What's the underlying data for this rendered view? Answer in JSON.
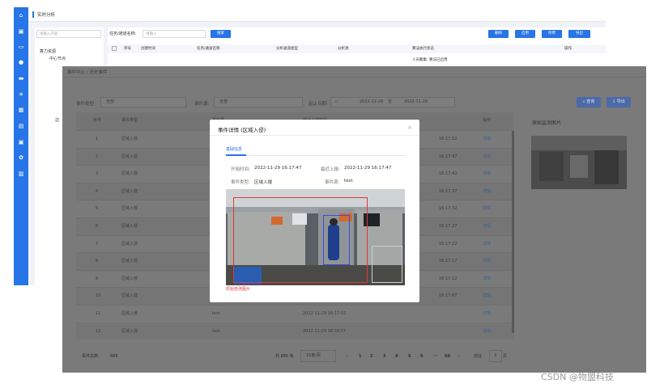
{
  "back": {
    "title": "实时分析",
    "search_placeholder": "请输入内容",
    "task_label": "任务/通道名称:",
    "task_placeholder": "请输入",
    "search_btn": "搜索",
    "actions": [
      "删除",
      "启用",
      "停用",
      "导出"
    ],
    "tree": [
      "算力资源",
      "中心节点",
      "边"
    ],
    "columns": [
      "序号",
      "创建时间",
      "任务/通道名称",
      "分析通道类型",
      "分析源",
      "算法执行状态",
      "操作"
    ],
    "row_status": "人员聚集: 算法已启用"
  },
  "win": {
    "breadcrumb": "事件中心 / 历史事件",
    "filter_type_label": "事件类型:",
    "filter_type_value": "全部",
    "filter_src_label": "事件源:",
    "filter_src_value": "全部",
    "date_label": "起止日期:",
    "date_start": "2022-11-29",
    "date_sep": "至",
    "date_end": "2022-11-29",
    "query_btn": "查询",
    "export_btn": "导出",
    "columns": [
      "序号",
      "事件类型",
      "事件源",
      "最近上报时间",
      "操作"
    ],
    "rows": [
      {
        "no": "1",
        "type": "区域入侵",
        "src": "",
        "time": "16:17:52",
        "op": "详情"
      },
      {
        "no": "2",
        "type": "区域入侵",
        "src": "",
        "time": "16:17:47",
        "op": "详情"
      },
      {
        "no": "3",
        "type": "区域入侵",
        "src": "",
        "time": "16:17:42",
        "op": "详情"
      },
      {
        "no": "4",
        "type": "区域入侵",
        "src": "",
        "time": "16:17:37",
        "op": "详情"
      },
      {
        "no": "5",
        "type": "区域入侵",
        "src": "",
        "time": "16:17:32",
        "op": "详情"
      },
      {
        "no": "6",
        "type": "区域入侵",
        "src": "",
        "time": "16:17:27",
        "op": "详情"
      },
      {
        "no": "7",
        "type": "区域入侵",
        "src": "",
        "time": "16:17:22",
        "op": "详情"
      },
      {
        "no": "8",
        "type": "区域入侵",
        "src": "",
        "time": "16:17:17",
        "op": "详情"
      },
      {
        "no": "9",
        "type": "区域入侵",
        "src": "",
        "time": "16:17:12",
        "op": "详情"
      },
      {
        "no": "10",
        "type": "区域入侵",
        "src": "",
        "time": "16:17:07",
        "op": "详情"
      },
      {
        "no": "11",
        "type": "区域入侵",
        "src": "test",
        "time": "2022-11-29 16:17:02",
        "op": "详情"
      },
      {
        "no": "12",
        "type": "区域入侵",
        "src": "test",
        "time": "2022-11-29 16:16:57",
        "op": "详情"
      }
    ],
    "total_label": "事件总数:",
    "total_value": "886",
    "pager_total": "共 886 条",
    "page_size": "15条/页",
    "pages": [
      "1",
      "2",
      "3",
      "4",
      "5",
      "6",
      "···",
      "60"
    ],
    "goto_label": "前往",
    "goto_value": "1",
    "goto_unit": "页",
    "side_title": "原始监测图片"
  },
  "modal": {
    "title": "事件详情 (区域入侵)",
    "tab": "基础信息",
    "start_label": "开始时间:",
    "start_value": "2022-11-29 16:17:47",
    "last_label": "最近上报:",
    "last_value": "2022-11-29 16:17:47",
    "type_label": "事件类型:",
    "type_value": "区域入侵",
    "src_label": "事件源:",
    "src_value": "test",
    "caption": "原始检测图片"
  },
  "watermark": "CSDN @物盟科技",
  "colors": {
    "accent": "#2775e6",
    "overlay": "#7a7a7a"
  }
}
